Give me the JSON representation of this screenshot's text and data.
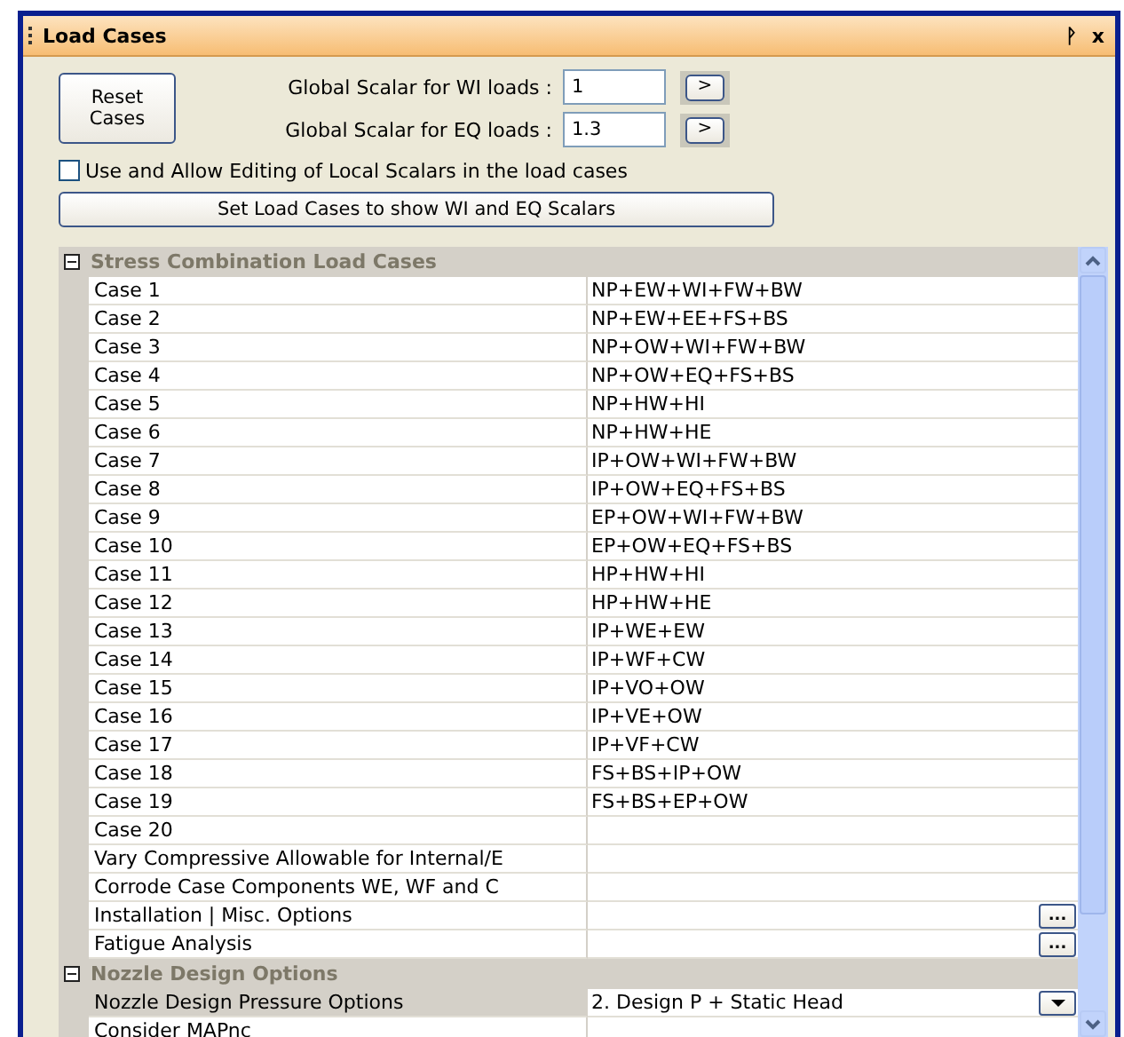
{
  "window": {
    "title": "Load Cases",
    "pin": "ᚹ",
    "close": "x"
  },
  "controls": {
    "reset_button": "Reset Cases",
    "scalars": [
      {
        "label": "Global Scalar for WI loads :",
        "value": "1",
        "button": ">"
      },
      {
        "label": "Global Scalar for EQ loads :",
        "value": "1.3",
        "button": ">"
      }
    ],
    "local_scalars": {
      "label": "Use and Allow Editing of Local Scalars in the load cases",
      "checked": false
    },
    "set_button": "Set Load Cases to show WI and EQ Scalars"
  },
  "grid": {
    "sections": [
      {
        "title": "Stress Combination Load Cases",
        "expanded": true,
        "rows": [
          {
            "kind": "text",
            "name": "Case 1",
            "value": "NP+EW+WI+FW+BW",
            "selected": false
          },
          {
            "kind": "text",
            "name": "Case 2",
            "value": "NP+EW+EE+FS+BS",
            "selected": false
          },
          {
            "kind": "text",
            "name": "Case 3",
            "value": "NP+OW+WI+FW+BW",
            "selected": false
          },
          {
            "kind": "text",
            "name": "Case 4",
            "value": "NP+OW+EQ+FS+BS",
            "selected": false
          },
          {
            "kind": "text",
            "name": "Case 5",
            "value": "NP+HW+HI",
            "selected": false
          },
          {
            "kind": "text",
            "name": "Case 6",
            "value": "NP+HW+HE",
            "selected": false
          },
          {
            "kind": "text",
            "name": "Case 7",
            "value": "IP+OW+WI+FW+BW",
            "selected": false
          },
          {
            "kind": "text",
            "name": "Case 8",
            "value": "IP+OW+EQ+FS+BS",
            "selected": false
          },
          {
            "kind": "text",
            "name": "Case 9",
            "value": "EP+OW+WI+FW+BW",
            "selected": false
          },
          {
            "kind": "text",
            "name": "Case 10",
            "value": "EP+OW+EQ+FS+BS",
            "selected": false
          },
          {
            "kind": "text",
            "name": "Case 11",
            "value": "HP+HW+HI",
            "selected": false
          },
          {
            "kind": "text",
            "name": "Case 12",
            "value": "HP+HW+HE",
            "selected": false
          },
          {
            "kind": "text",
            "name": "Case 13",
            "value": "IP+WE+EW",
            "selected": false
          },
          {
            "kind": "text",
            "name": "Case 14",
            "value": "IP+WF+CW",
            "selected": false
          },
          {
            "kind": "text",
            "name": "Case 15",
            "value": "IP+VO+OW",
            "selected": false
          },
          {
            "kind": "text",
            "name": "Case 16",
            "value": "IP+VE+OW",
            "selected": false
          },
          {
            "kind": "text",
            "name": "Case 17",
            "value": "IP+VF+CW",
            "selected": false
          },
          {
            "kind": "text",
            "name": "Case 18",
            "value": "FS+BS+IP+OW",
            "selected": false
          },
          {
            "kind": "text",
            "name": "Case 19",
            "value": "FS+BS+EP+OW",
            "selected": false
          },
          {
            "kind": "text",
            "name": "Case 20",
            "selected": false
          },
          {
            "kind": "text",
            "name": "Vary Compressive Allowable for Internal/E",
            "selected": false
          },
          {
            "kind": "text",
            "name": "Corrode Case Components WE, WF and C",
            "selected": false
          },
          {
            "kind": "dialog",
            "name": "Installation | Misc. Options",
            "button": "...",
            "selected": false
          },
          {
            "kind": "dialog",
            "name": "Fatigue Analysis",
            "button": "...",
            "selected": false
          }
        ]
      },
      {
        "title": "Nozzle Design Options",
        "expanded": true,
        "rows": [
          {
            "kind": "dropdown",
            "name": "Nozzle Design Pressure Options",
            "value": "2. Design P + Static Head",
            "selected": true
          },
          {
            "kind": "text",
            "name": "Consider MAPnc",
            "selected": false
          }
        ]
      }
    ]
  }
}
